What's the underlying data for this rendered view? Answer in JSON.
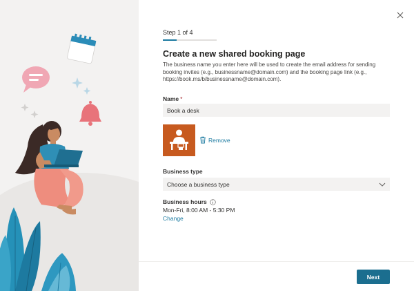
{
  "dialog": {
    "close_icon": "close-icon",
    "step": {
      "label": "Step 1 of 4",
      "current": 1,
      "total": 4
    },
    "title": "Create a new shared booking page",
    "description": "The business name you enter here will be used to create the email address for sending booking invites (e.g., businessname@domain.com) and the booking page link (e.g., https://book.ms/b/businessname@domain.com).",
    "name_field": {
      "label": "Name",
      "required_mark": "*",
      "value": "Book a desk"
    },
    "logo": {
      "icon": "desk-person-icon",
      "remove_icon": "trash-icon",
      "remove_label": "Remove"
    },
    "business_type": {
      "label": "Business type",
      "placeholder": "Choose a business type",
      "icon": "chevron-down-icon"
    },
    "business_hours": {
      "label": "Business hours",
      "info_icon": "info-icon",
      "value": "Mon-Fri, 8:00 AM - 5:30 PM",
      "change_label": "Change"
    },
    "footer": {
      "next_label": "Next"
    }
  },
  "colors": {
    "accent": "#1b7aa0",
    "button": "#1b6e8f",
    "logo_tile": "#c75a1f",
    "panel": "#f3f2f1",
    "required": "#a4262c"
  }
}
